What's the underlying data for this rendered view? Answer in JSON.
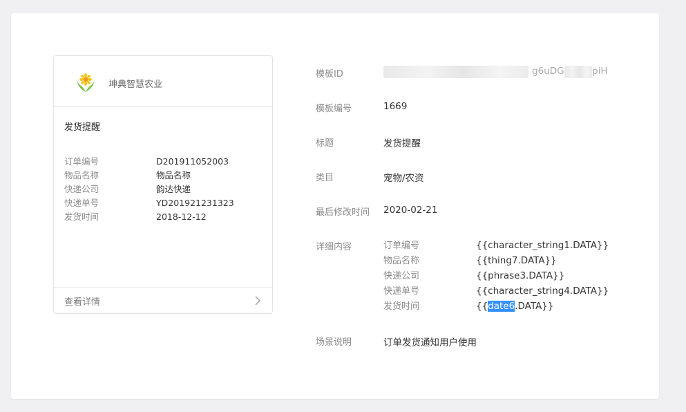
{
  "preview": {
    "account_name": "坤典智慧农业",
    "title": "发货提醒",
    "fields": [
      {
        "key": "订单编号",
        "value": "D201911052003"
      },
      {
        "key": "物品名称",
        "value": "物品名称"
      },
      {
        "key": "快递公司",
        "value": "韵达快递"
      },
      {
        "key": "快递单号",
        "value": "YD201921231323"
      },
      {
        "key": "发货时间",
        "value": "2018-12-12"
      }
    ],
    "footer_label": "查看详情"
  },
  "details": {
    "template_id_label": "模板ID",
    "template_id_visible_tail": "g6uDG",
    "template_id_visible_end": "piH",
    "template_no_label": "模板编号",
    "template_no": "1669",
    "title_label": "标题",
    "title": "发货提醒",
    "category_label": "类目",
    "category": "宠物/农资",
    "modified_label": "最后修改时间",
    "modified": "2020-02-21",
    "content_label": "详细内容",
    "content_rows": [
      {
        "key": "订单编号",
        "value": "{{character_string1.DATA}}"
      },
      {
        "key": "物品名称",
        "value": "{{thing7.DATA}}"
      },
      {
        "key": "快递公司",
        "value": "{{phrase3.DATA}}"
      },
      {
        "key": "快递单号",
        "value": "{{character_string4.DATA}}"
      }
    ],
    "last_row": {
      "key": "发货时间",
      "prefix": "{{",
      "selected": "date6",
      "suffix": ".DATA}}"
    },
    "scene_label": "场景说明",
    "scene": "订单发货通知用户使用"
  },
  "colors": {
    "selection": "#3390ff",
    "label": "#8a8a8a",
    "text": "#353535",
    "logo_green": "#6fbf3f",
    "logo_yellow": "#f2c21b"
  }
}
